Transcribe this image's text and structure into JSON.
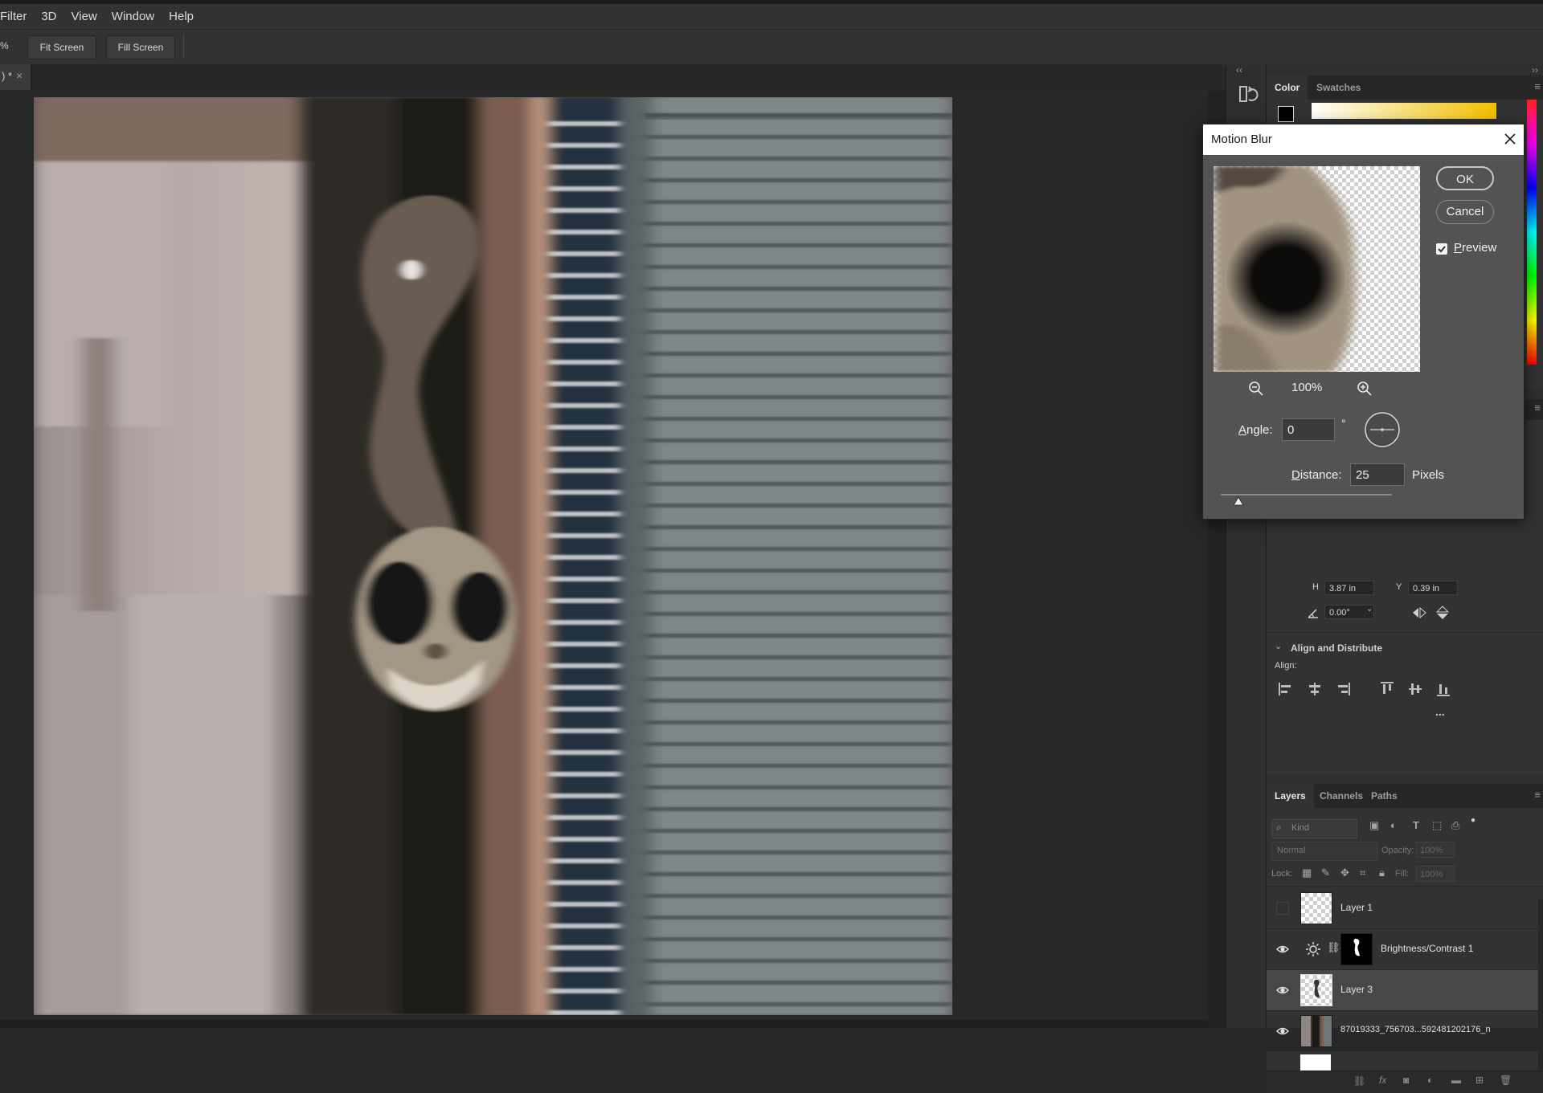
{
  "menu": [
    "Filter",
    "3D",
    "View",
    "Window",
    "Help"
  ],
  "options_bar": {
    "zoom_fragment": "%",
    "fit_screen": "Fit Screen",
    "fill_screen": "Fill Screen"
  },
  "document_tab": {
    "marker": ") *",
    "close": "×"
  },
  "color_panel": {
    "tabs": [
      "Color",
      "Swatches"
    ],
    "foreground": "#000000"
  },
  "properties": {
    "h_label": "H",
    "h_value": "3.87 in",
    "y_label": "Y",
    "y_value": "0.39 in",
    "angle_value": "0.00°",
    "align_title": "Align and Distribute",
    "align_label": "Align:",
    "more": "..."
  },
  "layers_panel": {
    "tabs": [
      "Layers",
      "Channels",
      "Paths"
    ],
    "kind_placeholder": "Kind",
    "blend_mode": "Normal",
    "opacity_label": "Opacity:",
    "opacity_value": "100%",
    "lock_label": "Lock:",
    "fill_label": "Fill:",
    "fill_value": "100%",
    "layers": [
      {
        "name": "Layer 1",
        "visible": false
      },
      {
        "name": "Brightness/Contrast 1",
        "visible": true
      },
      {
        "name": "Layer 3",
        "visible": true,
        "selected": true
      },
      {
        "name": "87019333_756703...592481202176_n",
        "visible": true
      }
    ]
  },
  "dialog": {
    "title": "Motion Blur",
    "ok": "OK",
    "cancel": "Cancel",
    "preview_label": "review",
    "preview_mnemonic": "P",
    "preview_checked": true,
    "zoom_percent": "100%",
    "angle_mnemonic": "A",
    "angle_label": "ngle:",
    "angle_value": "0",
    "degree": "°",
    "distance_mnemonic": "D",
    "distance_label": "istance:",
    "distance_value": "25",
    "distance_unit": "Pixels"
  }
}
